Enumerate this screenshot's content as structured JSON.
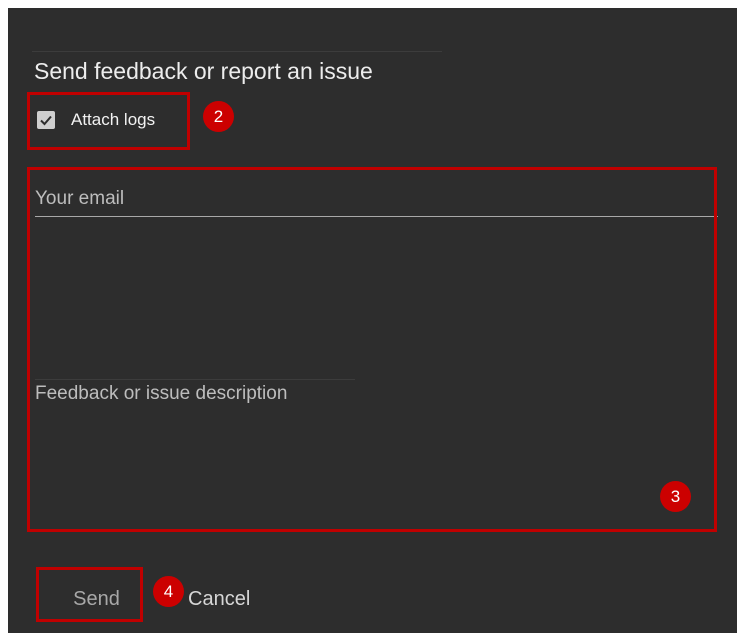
{
  "dialog": {
    "title": "Send feedback or report an issue",
    "attach_logs": {
      "label": "Attach logs",
      "checked": true
    },
    "email": {
      "placeholder": "Your email",
      "value": ""
    },
    "description": {
      "placeholder": "Feedback or issue description",
      "value": ""
    },
    "buttons": {
      "send_label": "Send",
      "cancel_label": "Cancel"
    }
  },
  "annotations": {
    "badge_2": "2",
    "badge_3": "3",
    "badge_4": "4",
    "color": "#c00000"
  },
  "colors": {
    "background": "#2d2d2d",
    "text": "#ededed",
    "disabled_text": "#a8a8a8"
  }
}
